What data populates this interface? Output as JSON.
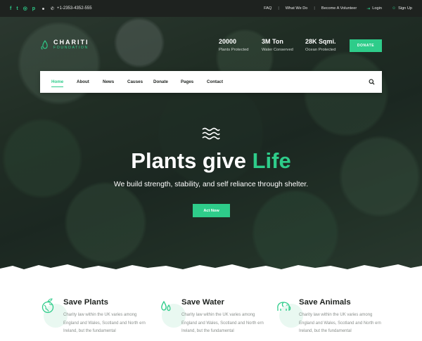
{
  "topbar": {
    "social_icons": [
      "facebook-icon",
      "twitter-icon",
      "instagram-icon",
      "pinterest-icon"
    ],
    "phone": "+1-2353-4352-555",
    "links": [
      "FAQ",
      "What We Do",
      "Become A Volunteer"
    ],
    "login_label": "Login",
    "signup_label": "Sign Up"
  },
  "brand": {
    "name": "CHARITI",
    "tagline": "FOUNDATION"
  },
  "stats": [
    {
      "value": "20000",
      "label": "Plants Protected"
    },
    {
      "value": "3M Ton",
      "label": "Water Conserved"
    },
    {
      "value": "28K Sqmi.",
      "label": "Ocean Protected"
    }
  ],
  "donate_label": "DONATE",
  "nav": {
    "items": [
      "Home",
      "About",
      "News",
      "Causes",
      "Donate",
      "Pages",
      "Contact"
    ],
    "active": "Home"
  },
  "hero": {
    "headline_main": "Plants give",
    "headline_accent": "Life",
    "subtitle": "We build strength, stability, and self reliance through shelter.",
    "cta_label": "Act Now"
  },
  "features": [
    {
      "icon": "globe-plant-icon",
      "title": "Save Plants",
      "desc": "Charity law within the UK varies among England and Wales, Scotland and North ern Ireland, but the fundamental"
    },
    {
      "icon": "water-drops-icon",
      "title": "Save Water",
      "desc": "Charity law within the UK varies among England and Wales, Scotland and North ern Ireland, but the fundamental"
    },
    {
      "icon": "elephant-icon",
      "title": "Save Animals",
      "desc": "Charity law within the UK varies among England and Wales, Scotland and North ern Ireland, but the fundamental"
    }
  ],
  "colors": {
    "accent": "#2ecc8a",
    "topbar_bg": "#1e221f",
    "text_dark": "#1e221f",
    "text_muted": "#8a8f8c"
  }
}
